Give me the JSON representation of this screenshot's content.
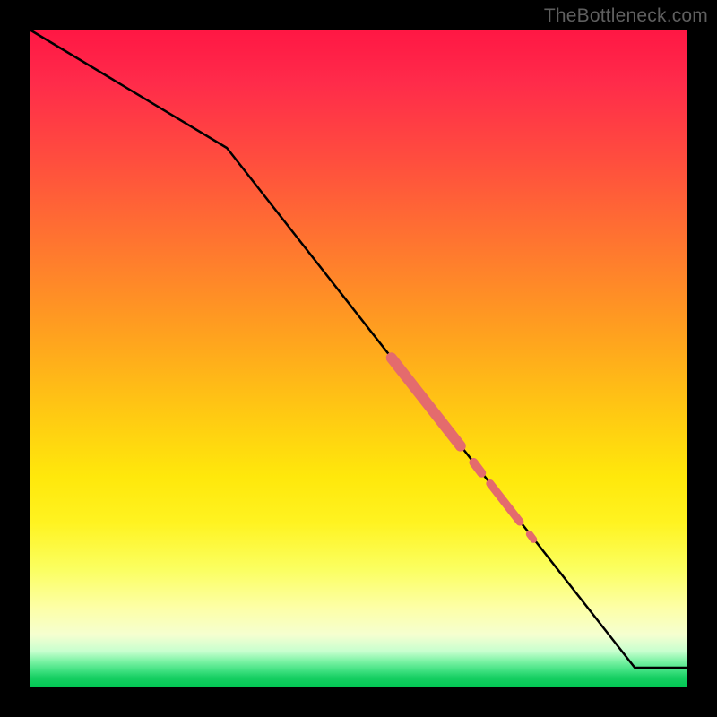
{
  "watermark": "TheBottleneck.com",
  "colors": {
    "curve": "#000000",
    "highlight": "#e46b6d",
    "highlight_stroke": "#c75a5c"
  },
  "chart_data": {
    "type": "line",
    "title": "",
    "xlabel": "",
    "ylabel": "",
    "xlim": [
      0,
      100
    ],
    "ylim": [
      0,
      100
    ],
    "grid": false,
    "legend": false,
    "series": [
      {
        "name": "bottleneck-curve",
        "x": [
          0,
          30,
          92,
          100
        ],
        "values": [
          100,
          82,
          3,
          3
        ]
      }
    ],
    "annotations": {
      "highlight_segments": [
        {
          "x0": 55.0,
          "y0": 50.1,
          "x1": 65.5,
          "y1": 36.7,
          "width": 12
        },
        {
          "x0": 67.5,
          "y0": 34.2,
          "x1": 68.7,
          "y1": 32.6,
          "width": 10
        },
        {
          "x0": 70.0,
          "y0": 31.0,
          "x1": 74.5,
          "y1": 25.2,
          "width": 9
        },
        {
          "x0": 76.0,
          "y0": 23.3,
          "x1": 76.6,
          "y1": 22.5,
          "width": 8
        }
      ]
    }
  }
}
